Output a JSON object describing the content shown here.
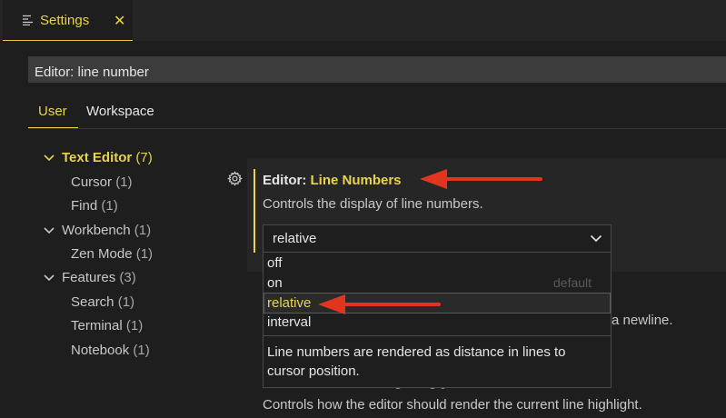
{
  "tab": {
    "title": "Settings",
    "close": "✕"
  },
  "search": {
    "value": "Editor: line number"
  },
  "scopes": {
    "user": "User",
    "workspace": "Workspace"
  },
  "toc": [
    {
      "label": "Text Editor",
      "count": "(7)"
    },
    {
      "label": "Cursor",
      "count": "(1)"
    },
    {
      "label": "Find",
      "count": "(1)"
    },
    {
      "label": "Workbench",
      "count": "(1)"
    },
    {
      "label": "Zen Mode",
      "count": "(1)"
    },
    {
      "label": "Features",
      "count": "(3)"
    },
    {
      "label": "Search",
      "count": "(1)"
    },
    {
      "label": "Terminal",
      "count": "(1)"
    },
    {
      "label": "Notebook",
      "count": "(1)"
    }
  ],
  "setting": {
    "category": "Editor: ",
    "name": "Line Numbers",
    "description": "Controls the display of line numbers.",
    "value": "relative",
    "options": [
      "off",
      "on",
      "relative",
      "interval"
    ],
    "default_tag": "default",
    "option_description": "Line numbers are rendered as distance in lines to cursor position."
  },
  "behind": {
    "partial_text": "a newline.",
    "next_description": "Controls how the editor should render the current line highlight."
  },
  "colors": {
    "accent": "#e8d44d",
    "annotation_arrow": "#e2351f"
  }
}
